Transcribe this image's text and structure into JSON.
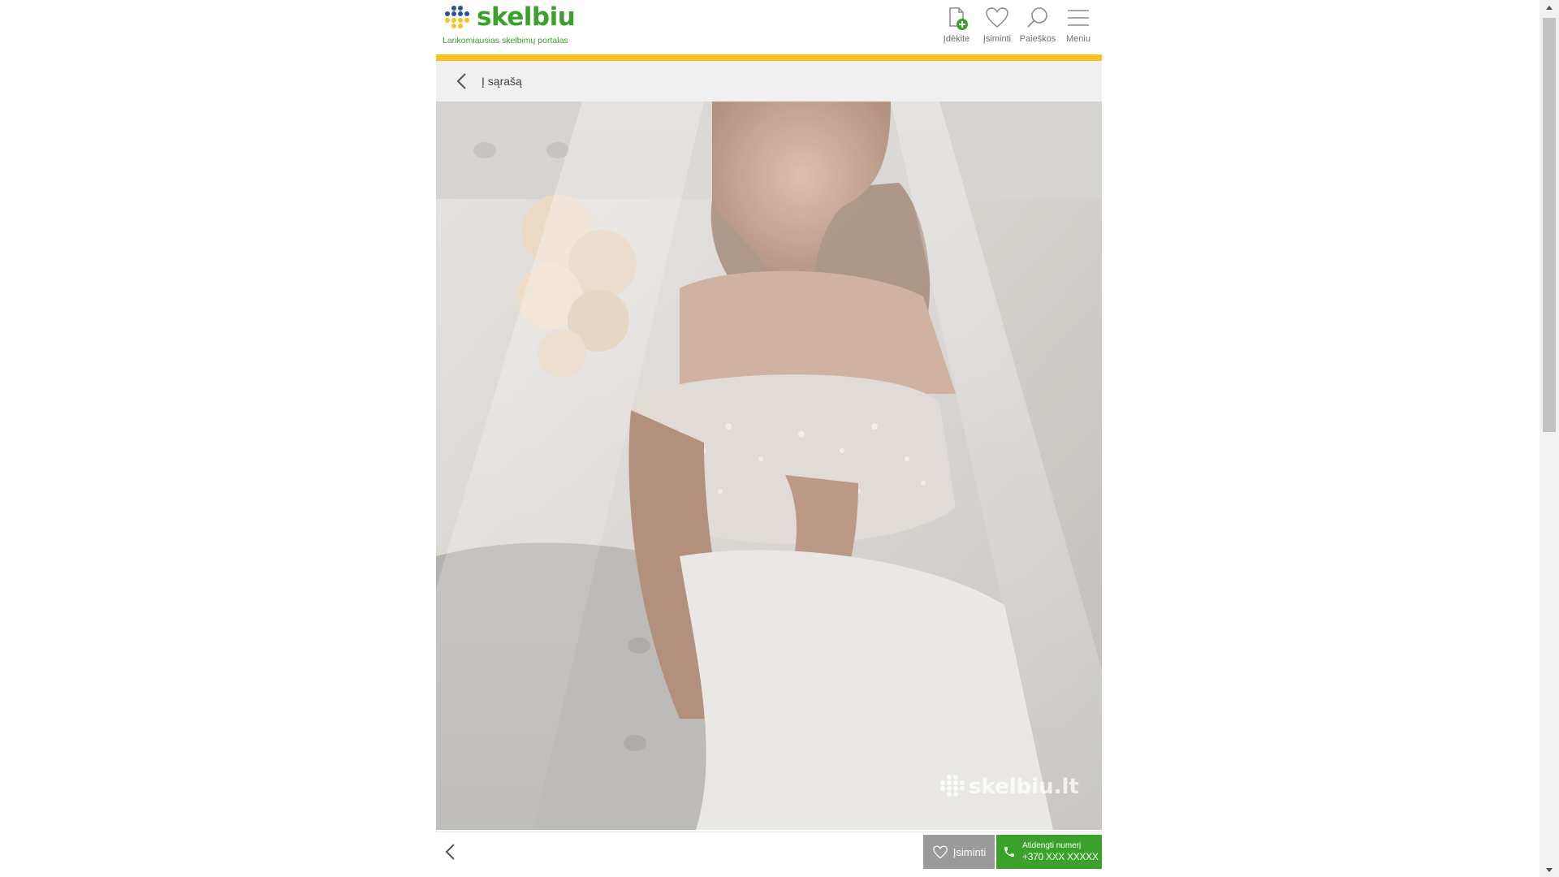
{
  "header": {
    "logo_text": "skelbiu",
    "tagline": "Lankomiausias skelbimų portalas",
    "nav": [
      {
        "label": "Įdėkite",
        "icon": "add-document-icon"
      },
      {
        "label": "Įsiminti",
        "icon": "heart-icon"
      },
      {
        "label": "Paieškos",
        "icon": "search-icon"
      },
      {
        "label": "Meniu",
        "icon": "hamburger-menu-icon"
      }
    ]
  },
  "back_bar": {
    "label": "Į sąrašą",
    "icon": "chevron-left-icon"
  },
  "photo": {
    "watermark": "skelbiu.lt"
  },
  "bottom_bar": {
    "prev_icon": "chevron-left-icon",
    "save_label": "Įsiminti",
    "phone_label": "Atidengti numerį",
    "phone_number": "+370 XXX XXXXX"
  },
  "colors": {
    "brand_green": "#3aa22a",
    "accent_yellow": "#f7c21e",
    "logo_blue": "#2a4f9e",
    "save_grey": "#9a9a9a"
  }
}
